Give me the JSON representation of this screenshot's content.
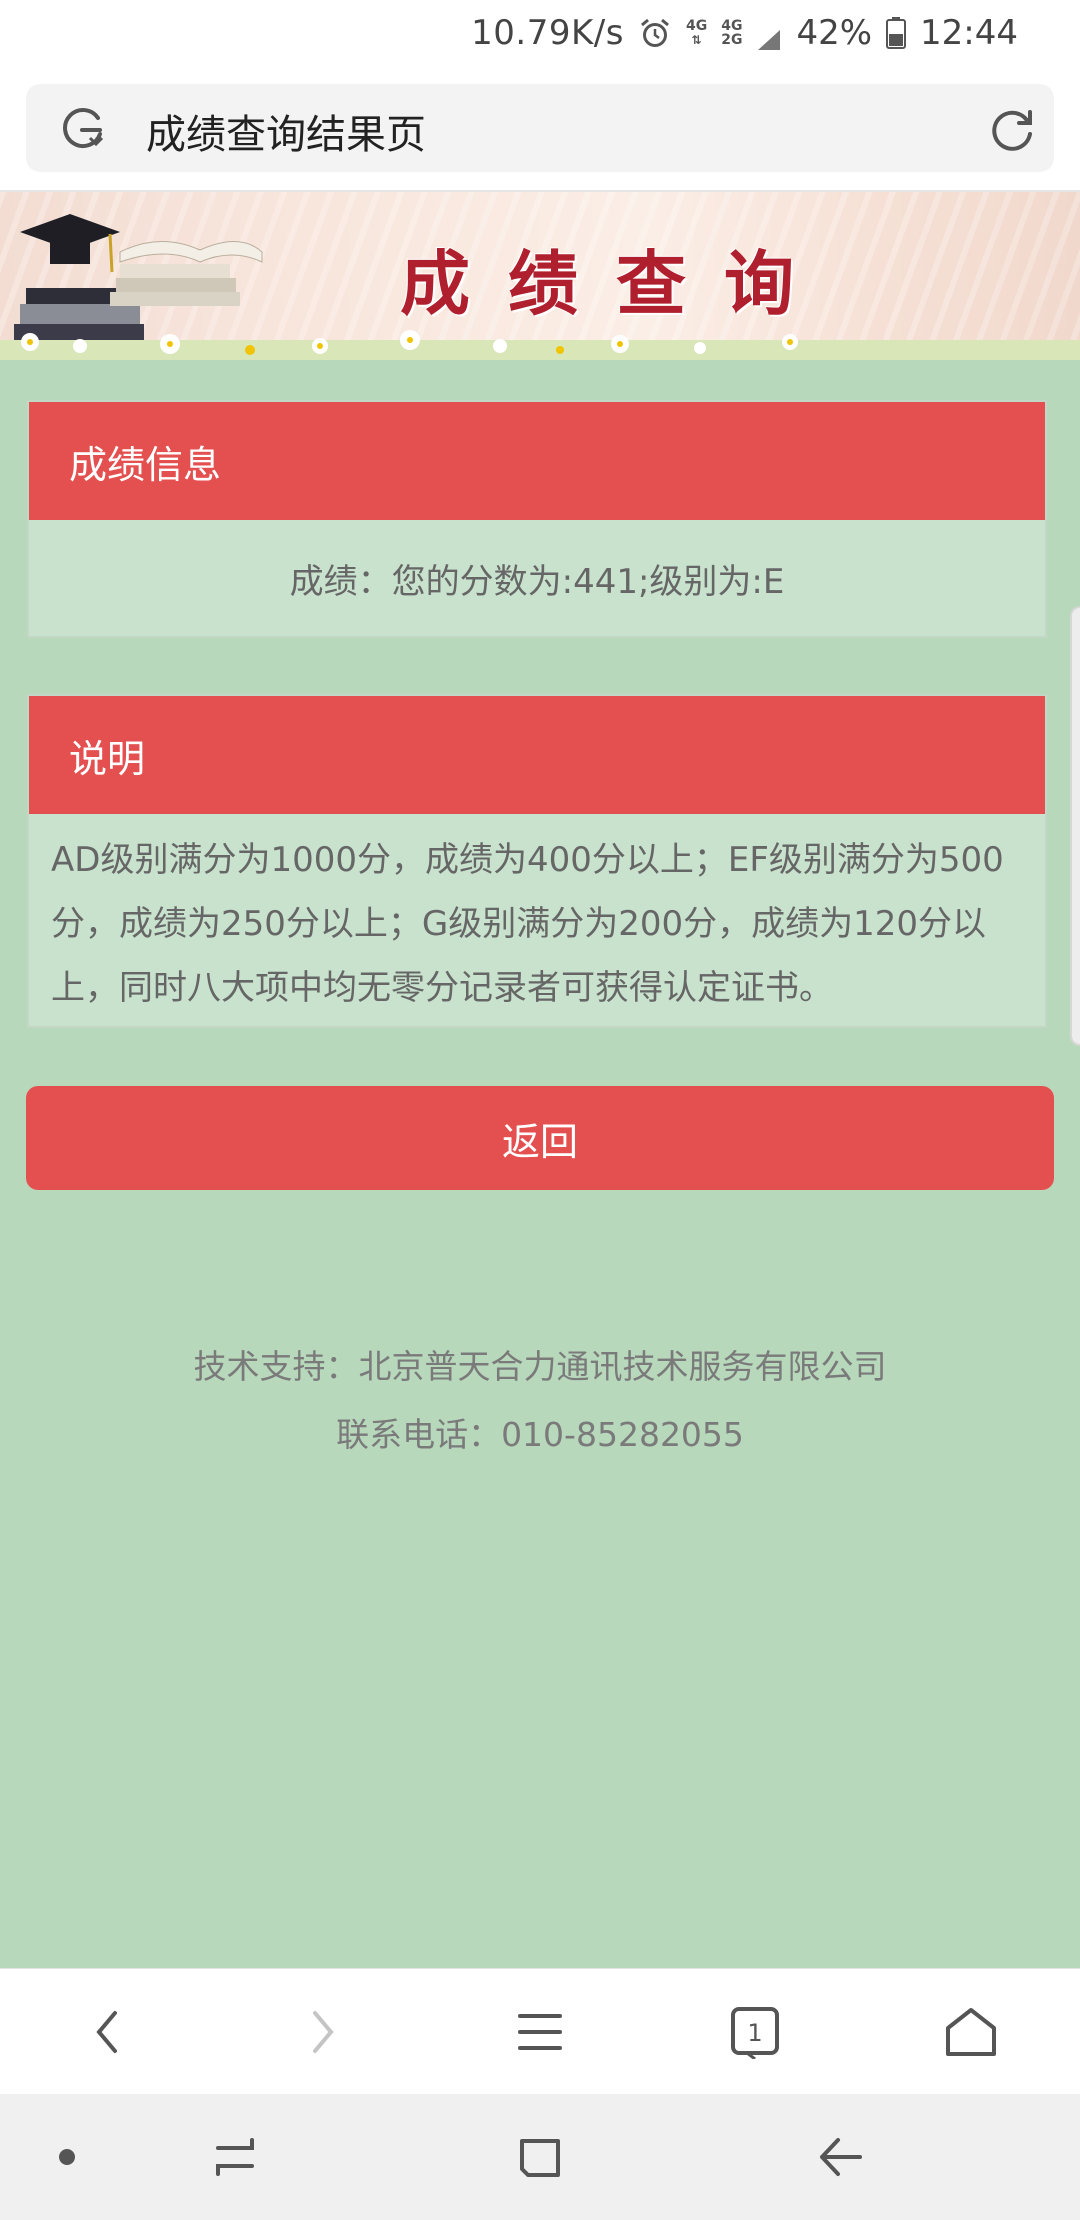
{
  "status_bar": {
    "net_speed": "10.79K/s",
    "network_labels": [
      "4G",
      "4G",
      "2G"
    ],
    "battery": "42%",
    "time": "12:44",
    "icons": [
      "alarm-icon",
      "signal-icon",
      "battery-icon"
    ]
  },
  "address_bar": {
    "title": "成绩查询结果页",
    "icons": [
      "browser-logo-icon",
      "reload-icon"
    ]
  },
  "banner": {
    "title": "成绩查询"
  },
  "score_panel": {
    "header": "成绩信息",
    "body": "成绩：您的分数为:441;级别为:E"
  },
  "note_panel": {
    "header": "说明",
    "lines": [
      "AD级别满分为1000分，成绩为400分以上；EF级别满分为500",
      "分，成绩为250分以上；G级别满分为200分，成绩为120分以",
      "上，同时八大项中均无零分记录者可获得认定证书。"
    ]
  },
  "return_button": {
    "label": "返回"
  },
  "footer": {
    "support": "技术支持：北京普天合力通讯技术服务有限公司",
    "phone": "联系电话：010-85282055"
  },
  "browser_toolbar": {
    "tab_count": "1",
    "icons": [
      "back-icon",
      "forward-icon",
      "menu-icon",
      "tabs-icon",
      "home-icon"
    ]
  },
  "nav_bar": {
    "icons": [
      "dot-icon",
      "recent-apps-icon",
      "home-square-icon",
      "nav-back-icon"
    ]
  },
  "colors": {
    "accent_red": "#e45050",
    "page_bg": "#b8d8bc",
    "panel_bg": "#c8e2cd",
    "banner_title": "#b01f2e"
  }
}
